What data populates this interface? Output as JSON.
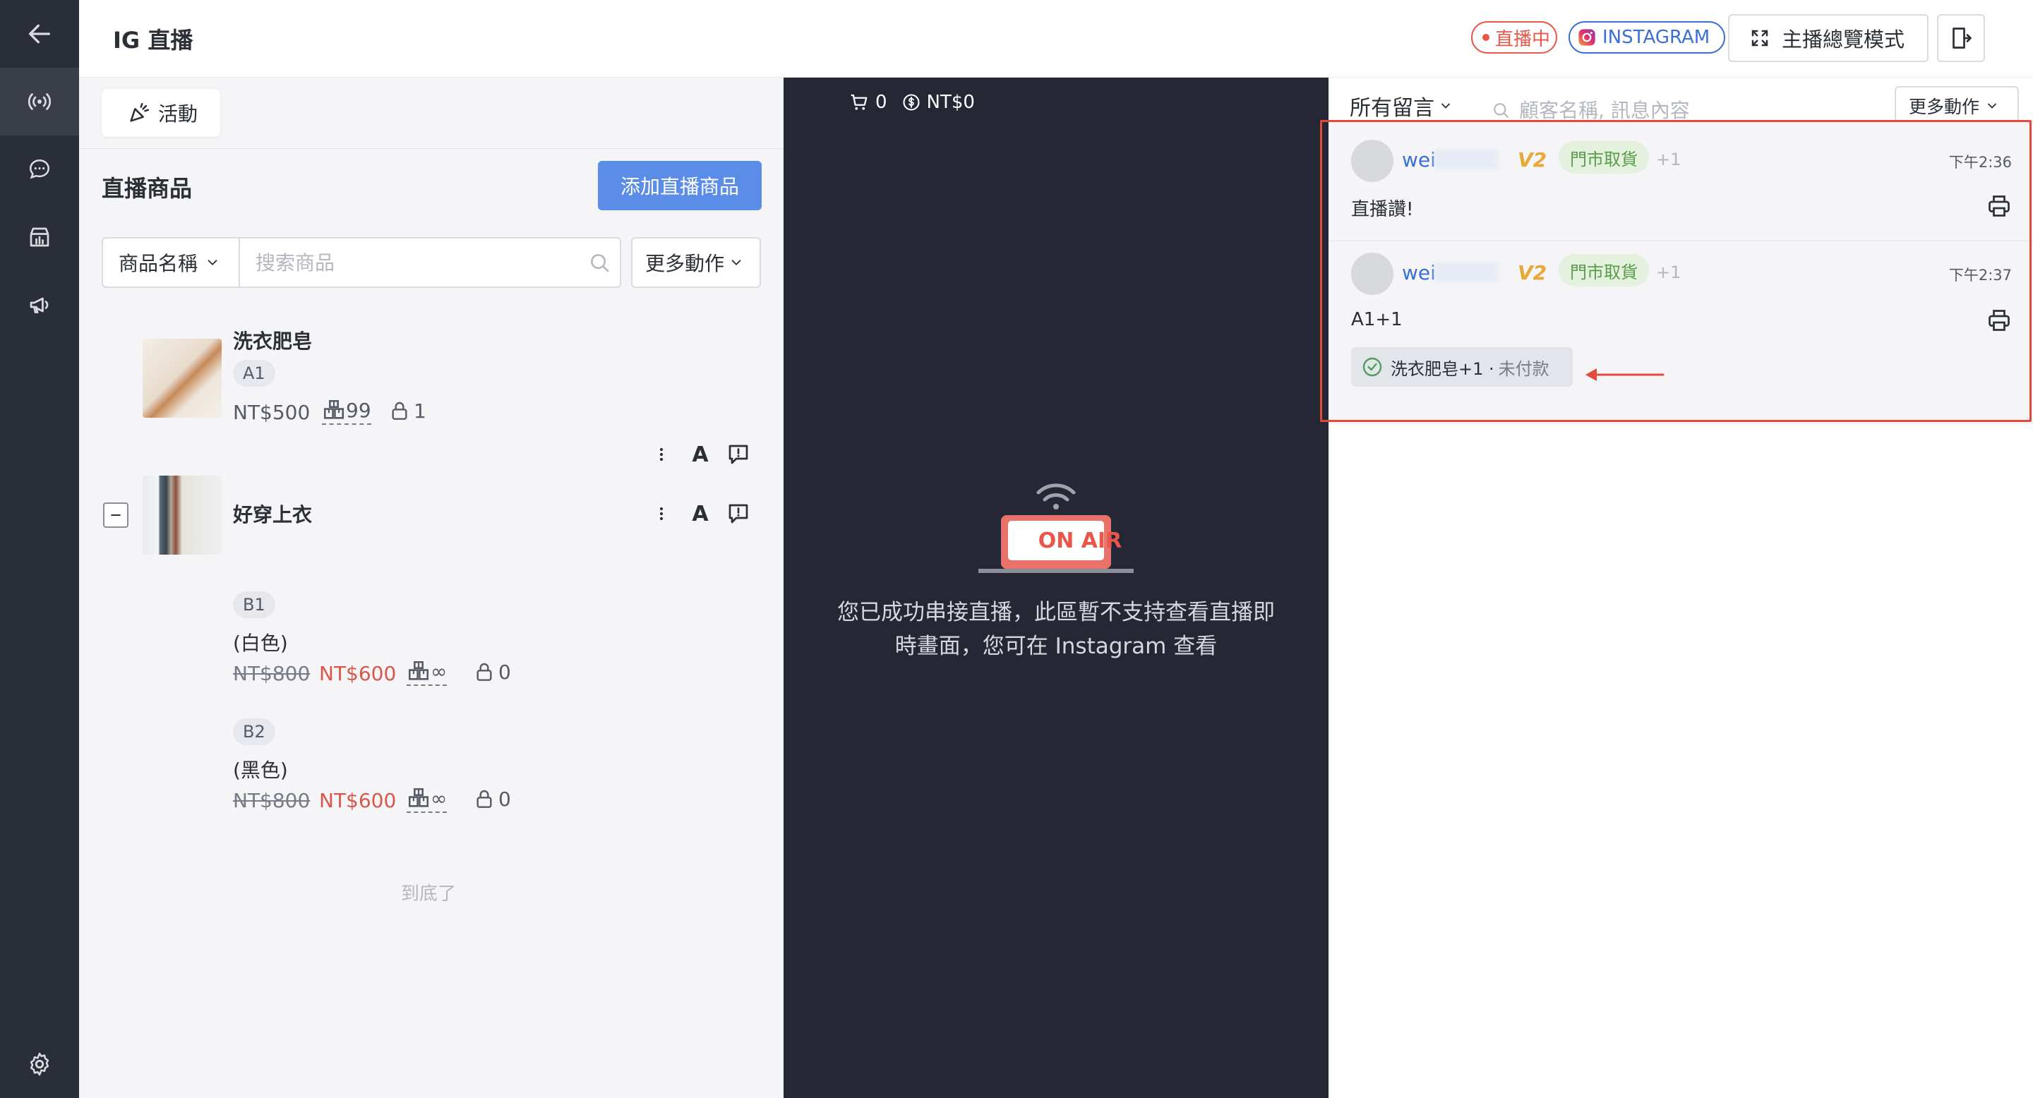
{
  "header": {
    "title": "IG 直播",
    "live_badge": "直播中",
    "platform_badge": "INSTAGRAM",
    "host_mode_label": "主播總覽模式"
  },
  "product_panel": {
    "activity_tab": "活動",
    "section_title": "直播商品",
    "add_button": "添加直播商品",
    "filter_label": "商品名稱",
    "search_placeholder": "搜索商品",
    "more_actions": "更多動作",
    "end_text": "到底了",
    "products": [
      {
        "name": "洗衣肥皂",
        "code": "A1",
        "price": "NT$500",
        "stock": "99",
        "locked": "1"
      },
      {
        "name": "好穿上衣",
        "variants": [
          {
            "code": "B1",
            "name": "(白色)",
            "old_price": "NT$800",
            "price": "NT$600",
            "stock": "∞",
            "locked": "0"
          },
          {
            "code": "B2",
            "name": "(黑色)",
            "old_price": "NT$800",
            "price": "NT$600",
            "stock": "∞",
            "locked": "0"
          }
        ]
      }
    ]
  },
  "video_panel": {
    "cart_count": "0",
    "cart_total": "NT$0",
    "on_air_label": "ON AIR",
    "message_line1": "您已成功串接直播，此區暫不支持查看直播即",
    "message_line2": "時畫面，您可在 Instagram 查看"
  },
  "comments_panel": {
    "filter_label": "所有留言",
    "search_placeholder": "顧客名稱, 訊息內容",
    "more_actions": "更多動作",
    "comments": [
      {
        "user": "wei",
        "vip": "V2",
        "pickup": "門市取貨",
        "plus": "+1",
        "time": "下午2:36",
        "text": "直播讚!"
      },
      {
        "user": "wei",
        "vip": "V2",
        "pickup": "門市取貨",
        "plus": "+1",
        "time": "下午2:37",
        "text": "A1+1",
        "order": {
          "item": "洗衣肥皂+1 · ",
          "status": "未付款"
        }
      }
    ]
  },
  "colors": {
    "sidebar_bg": "#2a2e38",
    "accent_blue": "#5b8de8",
    "live_red": "#e8574a",
    "highlight_red": "#e44a3a",
    "video_bg": "#252834"
  },
  "icons": [
    "back-arrow-icon",
    "broadcast-icon",
    "chat-icon",
    "store-chart-icon",
    "megaphone-icon",
    "settings-gear-icon",
    "instagram-icon",
    "fullscreen-icon",
    "exit-door-icon",
    "cart-icon",
    "coin-icon",
    "search-icon",
    "print-icon",
    "check-circle-icon"
  ]
}
